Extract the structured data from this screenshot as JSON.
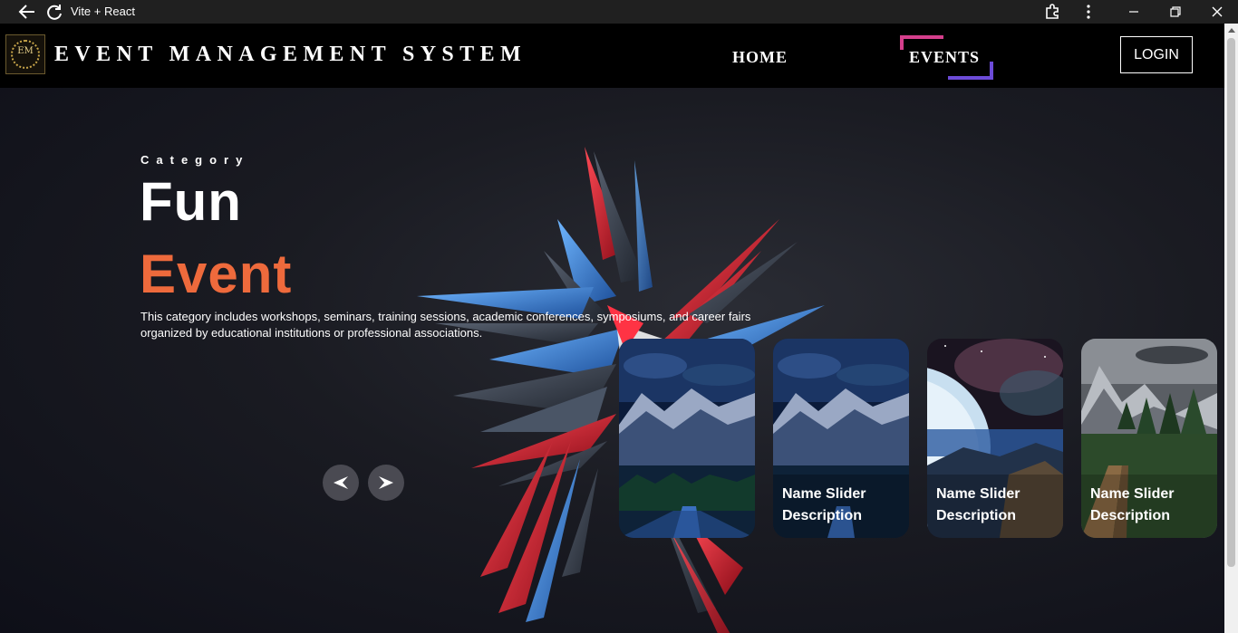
{
  "browser": {
    "title": "Vite + React"
  },
  "navbar": {
    "logo_text": "EM",
    "brand": "EVENT MANAGEMENT SYSTEM",
    "home_label": "HOME",
    "events_label": "EVENTS",
    "login_label": "LOGIN",
    "accent_pink": "#d53f8c",
    "accent_purple": "#6c4bd8"
  },
  "hero": {
    "category_label": "Category",
    "title_line1": "Fun",
    "title_line2": "Event",
    "title_line2_color": "#ee6a3c",
    "description": "This category includes workshops, seminars, training sessions, academic conferences, symposiums, and career fairs organized by educational institutions or professional associations.",
    "prev_icon": "arrow-left-icon",
    "next_icon": "arrow-right-icon"
  },
  "slides": [
    {
      "name": "",
      "description": "",
      "scene": "night-mountain-road"
    },
    {
      "name": "Name Slider",
      "description": "Description",
      "scene": "night-mountain-road"
    },
    {
      "name": "Name Slider",
      "description": "Description",
      "scene": "space-planet"
    },
    {
      "name": "Name Slider",
      "description": "Description",
      "scene": "mountain-forest-road"
    }
  ]
}
